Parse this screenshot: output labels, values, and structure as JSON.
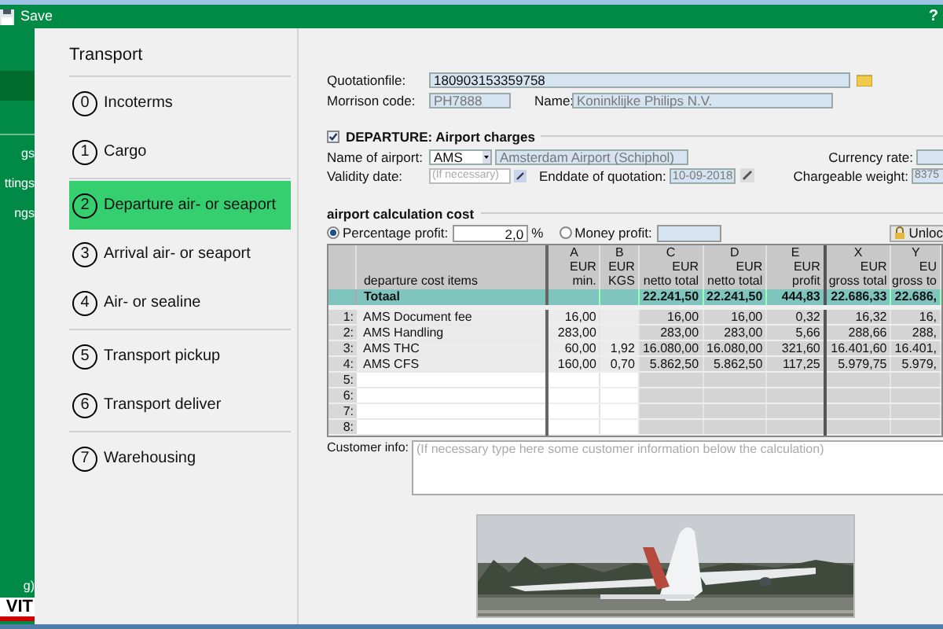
{
  "toolbar": {
    "save": "Save",
    "help": "?"
  },
  "sidebar": {
    "items": [
      {
        "label": "gs"
      },
      {
        "label": "ttings"
      },
      {
        "label": "ngs"
      }
    ],
    "footer": "g)",
    "logo": "VIT"
  },
  "nav": {
    "title": "Transport",
    "groups": [
      [
        {
          "number": "0",
          "label": "Incoterms",
          "selected": false
        },
        {
          "number": "1",
          "label": "Cargo",
          "selected": false
        }
      ],
      [
        {
          "number": "2",
          "label": "Departure air- or seaport",
          "selected": true
        },
        {
          "number": "3",
          "label": "Arrival air- or seaport",
          "selected": false
        },
        {
          "number": "4",
          "label": "Air- or sealine",
          "selected": false
        }
      ],
      [
        {
          "number": "5",
          "label": "Transport pickup",
          "selected": false
        },
        {
          "number": "6",
          "label": "Transport deliver",
          "selected": false
        }
      ],
      [
        {
          "number": "7",
          "label": "Warehousing",
          "selected": false
        }
      ]
    ]
  },
  "header": {
    "quotation_label": "Quotationfile:",
    "quotation_value": "180903153359758",
    "morrison_label": "Morrison code:",
    "morrison_value": "PH7888",
    "name_label": "Name:",
    "name_value": "Koninklijke Philips N.V."
  },
  "departure": {
    "checked": true,
    "title": "DEPARTURE: Airport charges",
    "airport_label": "Name of airport:",
    "airport_code": "AMS",
    "airport_name": "Amsterdam Airport (Schiphol)",
    "currency_label": "Currency rate:",
    "validity_label": "Validity date:",
    "validity_placeholder": "(If necessary)",
    "enddate_label": "Enddate of quotation:",
    "enddate_value": "10-09-2018",
    "weight_label": "Chargeable weight:",
    "weight_value": "8375"
  },
  "calculation": {
    "title": "airport calculation cost",
    "profit_options": [
      {
        "label": "Percentage profit:",
        "selected": true,
        "value": "2,0",
        "unit": "%"
      },
      {
        "label": "Money profit:",
        "selected": false
      }
    ],
    "unlock": "Unloc",
    "columns": [
      {
        "lines": [
          "A",
          "EUR",
          "min."
        ]
      },
      {
        "lines": [
          "B",
          "EUR",
          "KGS"
        ]
      },
      {
        "lines": [
          "C",
          "EUR",
          "netto total"
        ]
      },
      {
        "lines": [
          "D",
          "EUR",
          "netto total"
        ]
      },
      {
        "lines": [
          "E",
          "EUR",
          "profit"
        ]
      },
      {
        "lines": [
          "X",
          "EUR",
          "gross total"
        ]
      },
      {
        "lines": [
          "Y",
          "EU",
          "gross to"
        ]
      }
    ],
    "items_header": "departure cost items",
    "total": {
      "label": "Totaal",
      "cells": [
        null,
        null,
        "22.241,50",
        "22.241,50",
        "444,83",
        "22.686,33",
        "22.686,"
      ]
    },
    "rows": [
      {
        "num": "1:",
        "item": "AMS Document fee",
        "cells": [
          "16,00",
          null,
          "16,00",
          "16,00",
          "0,32",
          "16,32",
          "16,"
        ]
      },
      {
        "num": "2:",
        "item": "AMS Handling",
        "cells": [
          "283,00",
          null,
          "283,00",
          "283,00",
          "5,66",
          "288,66",
          "288,"
        ]
      },
      {
        "num": "3:",
        "item": "AMS THC",
        "cells": [
          "60,00",
          "1,92",
          "16.080,00",
          "16.080,00",
          "321,60",
          "16.401,60",
          "16.401,"
        ]
      },
      {
        "num": "4:",
        "item": "AMS CFS",
        "cells": [
          "160,00",
          "0,70",
          "5.862,50",
          "5.862,50",
          "117,25",
          "5.979,75",
          "5.979,"
        ]
      },
      {
        "num": "5:"
      },
      {
        "num": "6:"
      },
      {
        "num": "7:"
      },
      {
        "num": "8:"
      }
    ]
  },
  "customer": {
    "label": "Customer info:",
    "placeholder": "(If necessary type here some customer information below the calculation)"
  }
}
